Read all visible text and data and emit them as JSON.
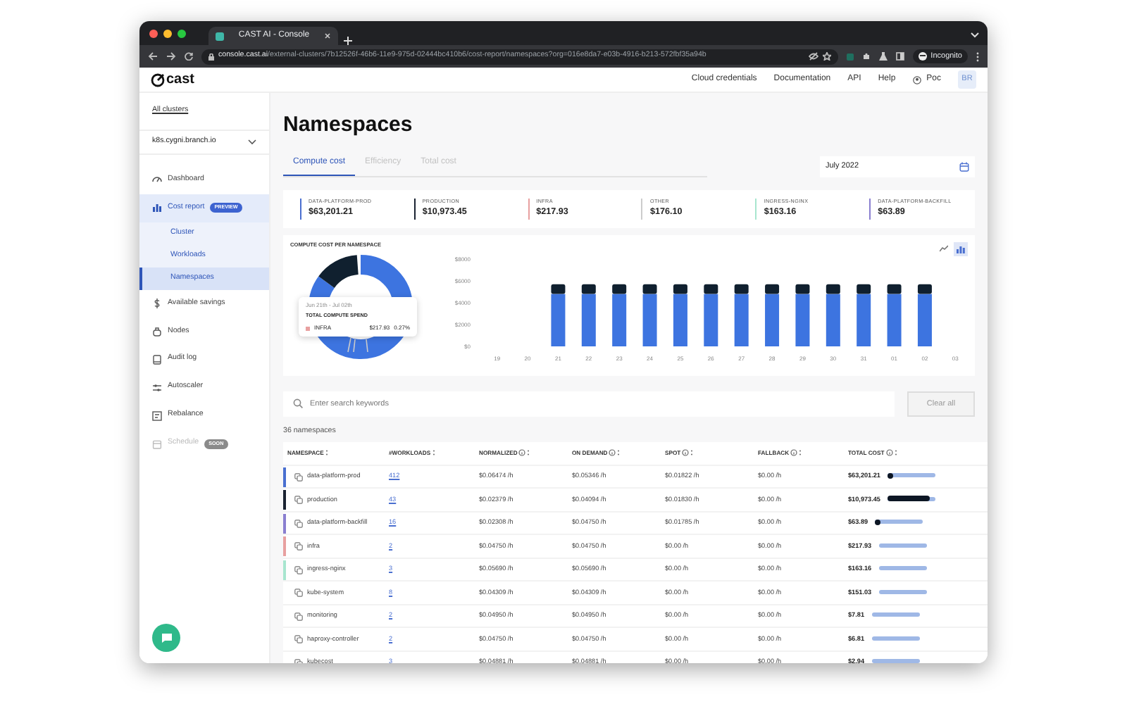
{
  "browser": {
    "tab_title": "CAST AI - Console",
    "url_host": "console.cast.ai",
    "url_path": "/external-clusters/7b12526f-46b6-11e9-975d-02444bc410b6/cost-report/namespaces?org=016e8da7-e03b-4916-b213-572fbf35a94b",
    "profile": "Incognito"
  },
  "app_header": {
    "logo": "cast",
    "links": [
      "Cloud credentials",
      "Documentation",
      "API",
      "Help"
    ],
    "user": "Poc",
    "avatar": "BR"
  },
  "sidebar": {
    "top_link": "All clusters",
    "cluster": "k8s.cygni.branch.io",
    "items": [
      {
        "label": "Dashboard",
        "selected": false,
        "disabled": false
      },
      {
        "label": "Cost report",
        "badge": "PREVIEW",
        "selected": true,
        "disabled": false,
        "children": [
          {
            "label": "Cluster",
            "selected": false
          },
          {
            "label": "Workloads",
            "selected": false
          },
          {
            "label": "Namespaces",
            "selected": true
          }
        ]
      },
      {
        "label": "Available savings",
        "selected": false,
        "disabled": false
      },
      {
        "label": "Nodes",
        "selected": false,
        "disabled": false
      },
      {
        "label": "Audit log",
        "selected": false,
        "disabled": false
      },
      {
        "label": "Autoscaler",
        "selected": false,
        "disabled": false
      },
      {
        "label": "Rebalance",
        "selected": false,
        "disabled": false
      },
      {
        "label": "Schedule",
        "badge": "SOON",
        "selected": false,
        "disabled": true
      }
    ]
  },
  "page": {
    "title": "Namespaces",
    "tabs": [
      {
        "label": "Compute cost",
        "selected": true
      },
      {
        "label": "Efficiency",
        "selected": false
      },
      {
        "label": "Total cost",
        "selected": false
      }
    ],
    "date": "July 2022"
  },
  "cost_cards": [
    {
      "label": "DATA-PLATFORM-PROD",
      "value": "$63,201.21",
      "color": "#4a6fd0"
    },
    {
      "label": "PRODUCTION",
      "value": "$10,973.45",
      "color": "#1a2332"
    },
    {
      "label": "INFRA",
      "value": "$217.93",
      "color": "#e8a0a0"
    },
    {
      "label": "OTHER",
      "value": "$176.10",
      "color": "#cccccc"
    },
    {
      "label": "INGRESS-NGINX",
      "value": "$163.16",
      "color": "#a8e6cf"
    },
    {
      "label": "DATA-PLATFORM-BACKFILL",
      "value": "$63.89",
      "color": "#8a7fd0"
    }
  ],
  "chart_panel": {
    "view_toggle": [
      {
        "kind": "line",
        "selected": false
      },
      {
        "kind": "bar",
        "selected": true
      }
    ],
    "tooltip": {
      "date": "Jun 21th - Jul 02th",
      "heading": "TOTAL COMPUTE SPEND",
      "name": "INFRA",
      "color": "#e8a0a0",
      "value": "$217.93",
      "share": "0.27%"
    },
    "chart_data": {
      "type": "bar",
      "title": "COMPUTE COST PER NAMESPACE",
      "stacked": true,
      "categories": [
        "19",
        "20",
        "21",
        "22",
        "23",
        "24",
        "25",
        "26",
        "27",
        "28",
        "29",
        "30",
        "31",
        "01",
        "02",
        "03"
      ],
      "series": [
        {
          "color": "#3d74e0",
          "values": [
            0,
            0,
            4800,
            4800,
            4800,
            4800,
            4800,
            4800,
            4800,
            4800,
            4800,
            4800,
            4800,
            4800,
            4800,
            0
          ]
        },
        {
          "color": "#10202f",
          "values": [
            0,
            0,
            900,
            900,
            900,
            900,
            900,
            900,
            900,
            900,
            900,
            900,
            900,
            900,
            900,
            0
          ]
        }
      ],
      "ylim": [
        0,
        8000
      ],
      "yticks": [
        {
          "value": 0,
          "label": "$0"
        },
        {
          "value": 2000,
          "label": "$2000"
        },
        {
          "value": 4000,
          "label": "$4000"
        },
        {
          "value": 6000,
          "label": "$6000"
        },
        {
          "value": 8000,
          "label": "$8000"
        }
      ]
    }
  },
  "search": {
    "placeholder": "Enter search keywords",
    "button": "Clear all"
  },
  "count": "36 namespaces",
  "table": {
    "columns": [
      {
        "label": "NAMESPACE",
        "info": false
      },
      {
        "label": "#WORKLOADS",
        "info": false
      },
      {
        "label": "NORMALIZED",
        "info": true
      },
      {
        "label": "ON DEMAND",
        "info": true
      },
      {
        "label": "SPOT",
        "info": true
      },
      {
        "label": "FALLBACK",
        "info": true
      },
      {
        "label": "TOTAL COST",
        "info": true
      }
    ],
    "rows": [
      {
        "cells": [
          "data-platform-prod",
          "412",
          "$0.06474 /h",
          "$0.05346 /h",
          "$0.01822 /h",
          "$0.00 /h",
          "$63,201.21"
        ],
        "color": "#4a6fd0",
        "level": 0.04
      },
      {
        "cells": [
          "production",
          "43",
          "$0.02379 /h",
          "$0.04094 /h",
          "$0.01830 /h",
          "$0.00 /h",
          "$10,973.45"
        ],
        "color": "#1a2332",
        "level": 0.88
      },
      {
        "cells": [
          "data-platform-backfill",
          "16",
          "$0.02308 /h",
          "$0.04750 /h",
          "$0.01785 /h",
          "$0.00 /h",
          "$63.89"
        ],
        "color": "#8a7fd0",
        "level": 0.04
      },
      {
        "cells": [
          "infra",
          "2",
          "$0.04750 /h",
          "$0.04750 /h",
          "$0.00 /h",
          "$0.00 /h",
          "$217.93"
        ],
        "color": "#e8a0a0"
      },
      {
        "cells": [
          "ingress-nginx",
          "3",
          "$0.05690 /h",
          "$0.05690 /h",
          "$0.00 /h",
          "$0.00 /h",
          "$163.16"
        ],
        "color": "#a8e6cf"
      },
      {
        "cells": [
          "kube-system",
          "8",
          "$0.04309 /h",
          "$0.04309 /h",
          "$0.00 /h",
          "$0.00 /h",
          "$151.03"
        ]
      },
      {
        "cells": [
          "monitoring",
          "2",
          "$0.04950 /h",
          "$0.04950 /h",
          "$0.00 /h",
          "$0.00 /h",
          "$7.81"
        ]
      },
      {
        "cells": [
          "haproxy-controller",
          "2",
          "$0.04750 /h",
          "$0.04750 /h",
          "$0.00 /h",
          "$0.00 /h",
          "$6.81"
        ]
      },
      {
        "cells": [
          "kubecost",
          "3",
          "$0.04881 /h",
          "$0.04881 /h",
          "$0.00 /h",
          "$0.00 /h",
          "$2.94"
        ]
      }
    ]
  }
}
